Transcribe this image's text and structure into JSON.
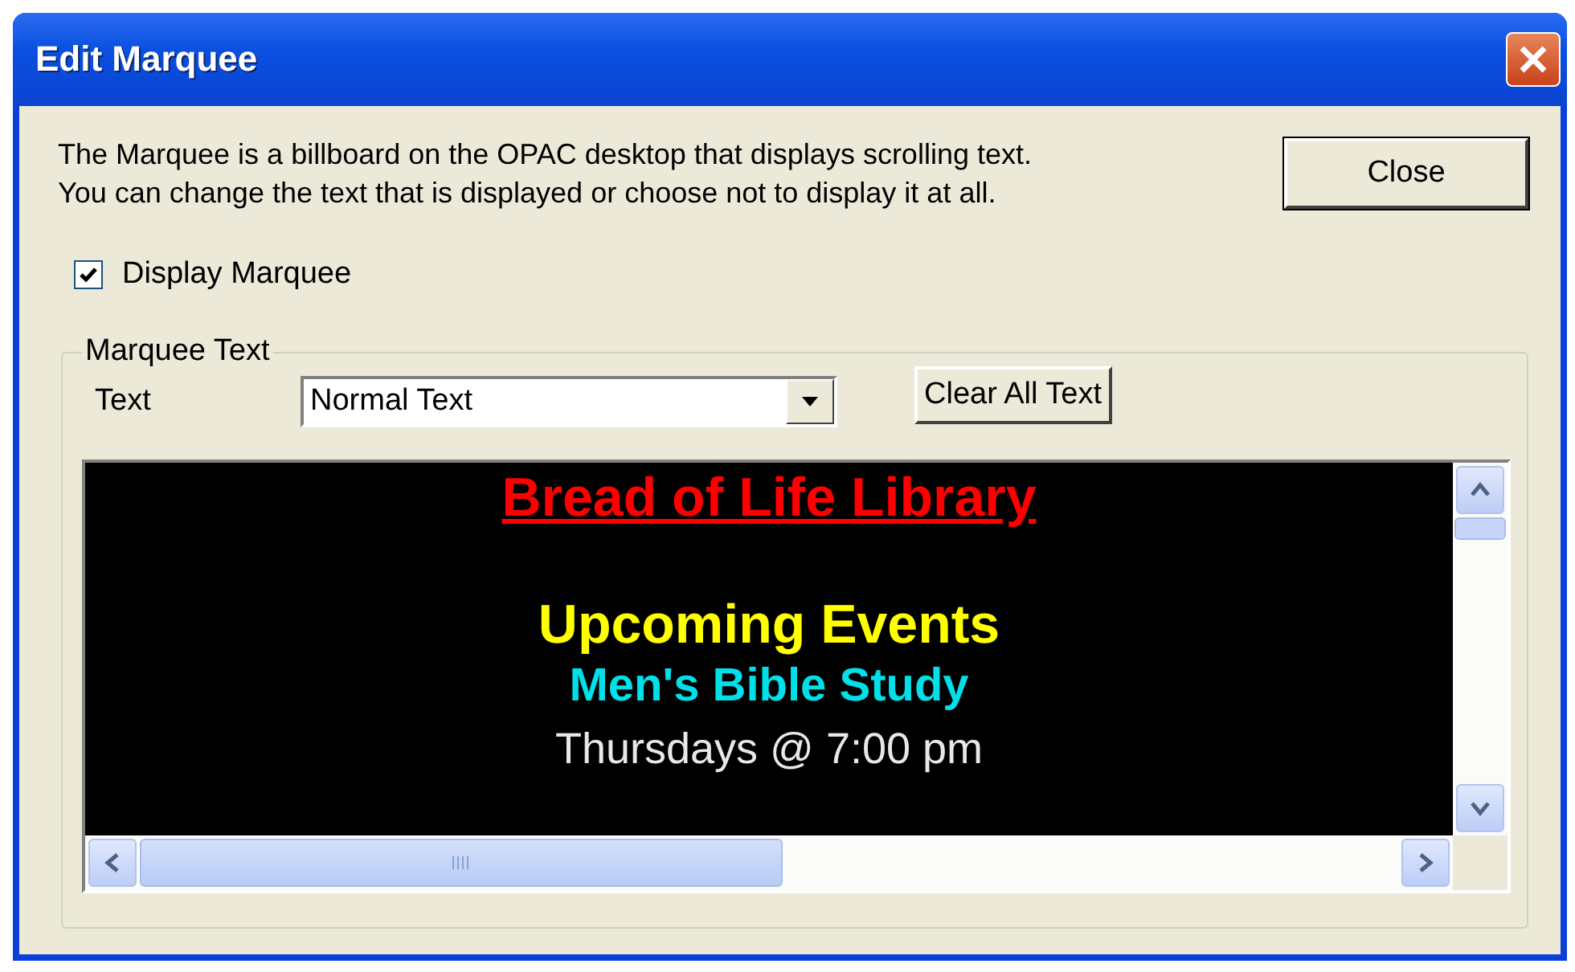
{
  "window": {
    "title": "Edit Marquee"
  },
  "description": [
    "The Marquee is a billboard on the OPAC desktop that displays scrolling text.",
    "You can change the text that is displayed or choose not to display it at all."
  ],
  "close_button": "Close",
  "display_marquee": {
    "label": "Display Marquee",
    "checked": true
  },
  "group": {
    "title": "Marquee Text",
    "text_label": "Text",
    "text_select": {
      "value": "Normal Text"
    },
    "clear_button": "Clear All Text"
  },
  "marquee_lines": [
    {
      "text": "Bread of Life Library",
      "kind": "title",
      "color": "#ff0000"
    },
    {
      "text": "Upcoming Events",
      "kind": "heading",
      "color": "#ffff00"
    },
    {
      "text": "Men's Bible Study",
      "kind": "subheading",
      "color": "#00e0e8"
    },
    {
      "text": "Thursdays @ 7:00 pm",
      "kind": "body",
      "color": "#e8e8e8"
    }
  ]
}
